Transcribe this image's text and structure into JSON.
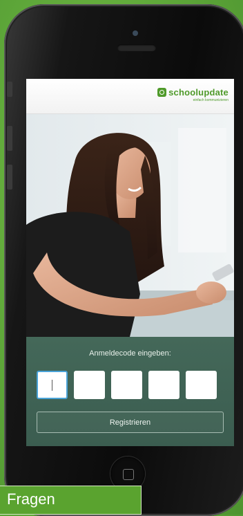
{
  "brand": {
    "name": "schoolupdate",
    "tagline": "einfach kommunizieren",
    "color": "#4f9a2a"
  },
  "login": {
    "prompt": "Anmeldecode eingeben:",
    "code_digits": [
      "",
      "",
      "",
      "",
      ""
    ],
    "active_index": 0,
    "register_label": "Registrieren"
  },
  "overlay": {
    "fragen_label": "Fragen"
  },
  "colors": {
    "panel": "#3e6254",
    "background": "#6db742",
    "active_border": "#4aa3d8"
  },
  "icons": {
    "logo": "schoolupdate-logo-icon",
    "home": "home-button-icon"
  }
}
